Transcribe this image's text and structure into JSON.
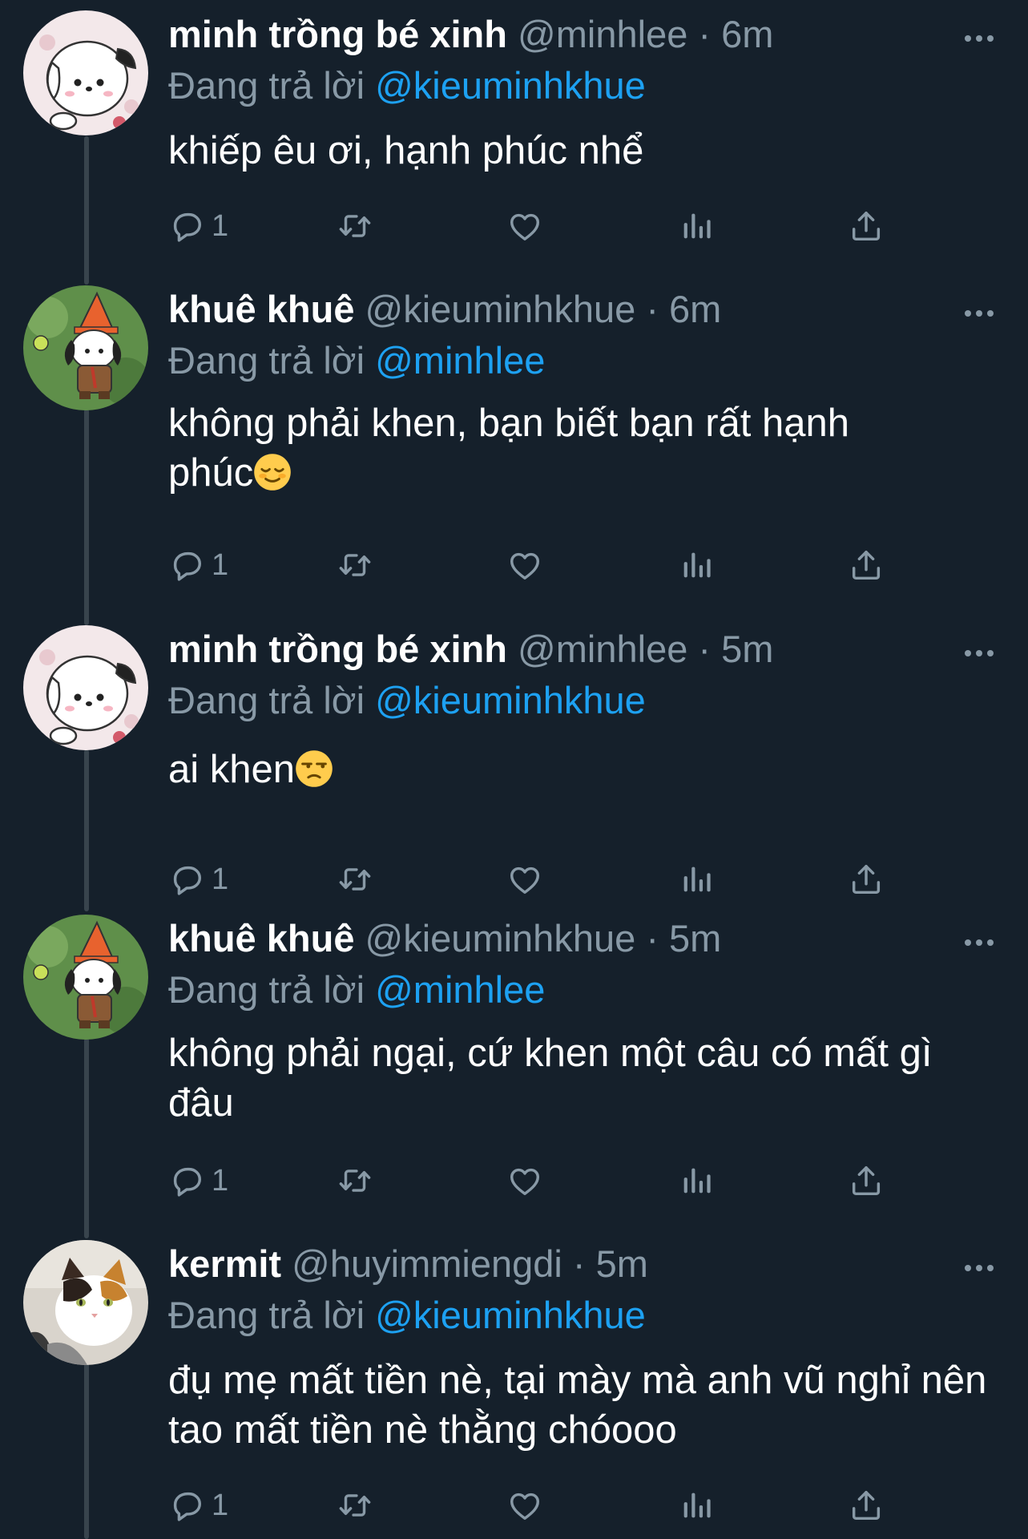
{
  "theme": {
    "background": "#15202b",
    "primary_text": "#ffffff",
    "secondary_text": "#8899a6",
    "link": "#1da1f2",
    "thread_line": "#38444d"
  },
  "reply_prefix": "Đang trả lời",
  "tweets": [
    {
      "display_name": "minh trồng bé xinh",
      "handle": "@minhlee",
      "dot": "·",
      "time": "6m",
      "reply_to": "@kieuminhkhue",
      "text": "khiếp êu ơi, hạnh phúc nhể",
      "emoji": "",
      "reply_count": "1",
      "avatar": "pochacco-sitting-icon"
    },
    {
      "display_name": "khuê khuê",
      "handle": "@kieuminhkhue",
      "dot": "·",
      "time": "6m",
      "reply_to": "@minhlee",
      "text": "không phải khen, bạn biết bạn rất hạnh phúc",
      "emoji": "relieved-face-emoji",
      "reply_count": "1",
      "avatar": "pochacco-cone-hat-icon"
    },
    {
      "display_name": "minh trồng bé xinh",
      "handle": "@minhlee",
      "dot": "·",
      "time": "5m",
      "reply_to": "@kieuminhkhue",
      "text": "ai khen",
      "emoji": "unamused-face-emoji",
      "reply_count": "1",
      "avatar": "pochacco-sitting-icon"
    },
    {
      "display_name": "khuê khuê",
      "handle": "@kieuminhkhue",
      "dot": "·",
      "time": "5m",
      "reply_to": "@minhlee",
      "text": "không phải ngại, cứ khen một câu có mất gì đâu",
      "emoji": "",
      "reply_count": "1",
      "avatar": "pochacco-cone-hat-icon"
    },
    {
      "display_name": "kermit",
      "handle": "@huyimmiengdi",
      "dot": "·",
      "time": "5m",
      "reply_to": "@kieuminhkhue",
      "text": "đụ mẹ mất tiền nè, tại mày mà anh vũ nghỉ nên tao mất tiền nè thằng chóooo",
      "emoji": "",
      "reply_count": "1",
      "avatar": "calico-cat-photo"
    }
  ]
}
